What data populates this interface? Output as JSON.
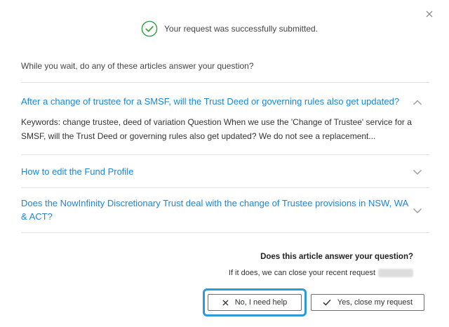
{
  "dialog": {
    "close_icon": "close-icon",
    "success_icon": "check-circle-icon",
    "success_message": "Your request was successfully submitted.",
    "intro": "While you wait, do any of these articles answer your question?"
  },
  "articles": [
    {
      "title": "After a change of trustee for a SMSF, will the Trust Deed or governing rules also get updated?",
      "expanded": true,
      "chevron_icon": "chevron-up-icon",
      "excerpt": "Keywords: change trustee, deed of variation Question When we use the 'Change of Trustee' service for a SMSF, will the Trust Deed or governing rules also get updated? We do not see a replacement..."
    },
    {
      "title": "How to edit the Fund Profile",
      "expanded": false,
      "chevron_icon": "chevron-down-icon"
    },
    {
      "title": "Does the NowInfinity Discretionary Trust deal with the change of Trustee provisions in NSW, WA & ACT?",
      "expanded": false,
      "chevron_icon": "chevron-down-icon"
    }
  ],
  "feedback": {
    "question": "Does this article answer your question?",
    "info": "If it does, we can close your recent request",
    "no_button": {
      "label": "No, I need help",
      "icon": "x-icon",
      "focused": true
    },
    "yes_button": {
      "label": "Yes, close my request",
      "icon": "checkmark-icon"
    }
  },
  "colors": {
    "link": "#1a86d6",
    "success": "#2e9b45",
    "focus_ring": "#2b9ad6",
    "divider": "#e2e2e2"
  }
}
